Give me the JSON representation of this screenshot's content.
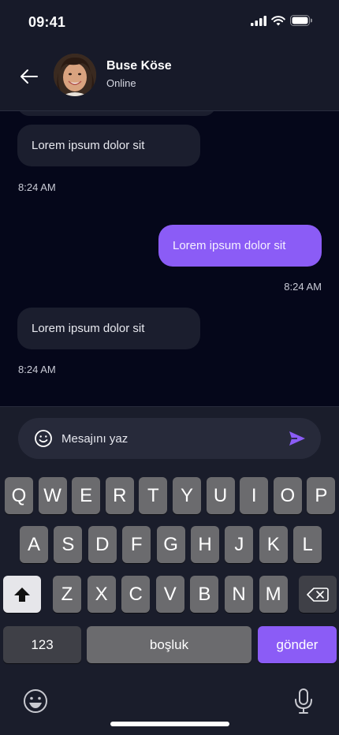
{
  "status": {
    "time": "09:41"
  },
  "header": {
    "name": "Buse Köse",
    "status": "Online"
  },
  "messages": [
    {
      "dir": "in",
      "text": "Lorem ipsum dolor sit",
      "time": "8:24 AM"
    },
    {
      "dir": "out",
      "text": "Lorem ipsum dolor sit",
      "time": "8:24 AM"
    },
    {
      "dir": "in",
      "text": "Lorem ipsum dolor sit",
      "time": "8:24 AM"
    }
  ],
  "composer": {
    "placeholder": "Mesajını yaz"
  },
  "keyboard": {
    "row1": [
      "Q",
      "W",
      "E",
      "R",
      "T",
      "Y",
      "U",
      "I",
      "O",
      "P"
    ],
    "row2": [
      "A",
      "S",
      "D",
      "F",
      "G",
      "H",
      "J",
      "K",
      "L"
    ],
    "row3": [
      "Z",
      "X",
      "C",
      "V",
      "B",
      "N",
      "M"
    ],
    "numbers_label": "123",
    "space_label": "boşluk",
    "send_label": "gönder"
  },
  "colors": {
    "accent": "#8b5cf6",
    "background": "#05071a",
    "panel": "#171a29"
  },
  "icons": [
    "back-arrow-icon",
    "emoji-icon",
    "send-icon",
    "shift-icon",
    "backspace-icon",
    "microphone-icon",
    "signal-icon",
    "wifi-icon",
    "battery-icon"
  ]
}
